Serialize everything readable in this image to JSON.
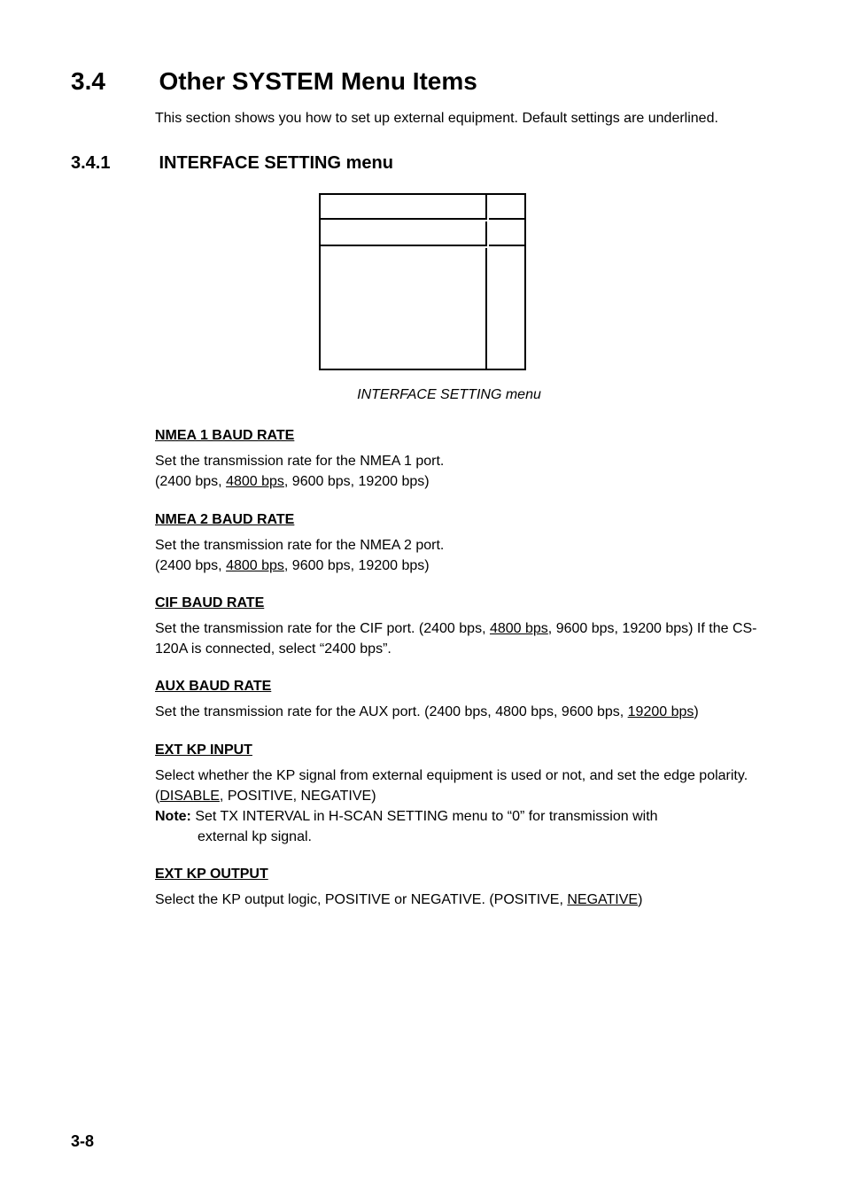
{
  "section": {
    "number": "3.4",
    "title": "Other SYSTEM Menu Items",
    "intro": "This section shows you how to set up external equipment. Default settings are underlined."
  },
  "subsection": {
    "number": "3.4.1",
    "title": "INTERFACE SETTING menu"
  },
  "figure": {
    "caption": "INTERFACE SETTING menu"
  },
  "items": {
    "nmea1": {
      "header": "NMEA 1 BAUD RATE",
      "line1": "Set the transmission rate for the NMEA 1 port.",
      "prefix": "(2400 bps, ",
      "default": "4800 bps",
      "suffix": ", 9600 bps, 19200 bps)"
    },
    "nmea2": {
      "header": "NMEA 2 BAUD RATE",
      "line1": "Set the transmission rate for the NMEA 2 port.",
      "prefix": "(2400 bps, ",
      "default": "4800 bps",
      "suffix": ", 9600 bps, 19200 bps)"
    },
    "cif": {
      "header": "CIF BAUD RATE",
      "prefix": "Set the transmission rate for the CIF port. (2400 bps, ",
      "default": "4800 bps",
      "suffix": ", 9600 bps, 19200 bps) If the CS-120A is connected, select “2400 bps”."
    },
    "aux": {
      "header": "AUX BAUD RATE",
      "prefix": "Set the transmission rate for the AUX port. (2400 bps, 4800 bps, 9600 bps, ",
      "default": "19200 bps",
      "suffix": ")"
    },
    "kpin": {
      "header": "EXT KP INPUT",
      "prefix": "Select whether the KP signal from external equipment is used or not, and set the edge polarity. (",
      "default": "DISABLE",
      "suffix": ", POSITIVE, NEGATIVE)",
      "note_label": "Note:",
      "note_text": " Set TX INTERVAL in H-SCAN SETTING menu to “0” for transmission with",
      "note_cont": "external kp signal."
    },
    "kpout": {
      "header": "EXT KP OUTPUT",
      "prefix": "Select the KP output logic, POSITIVE or NEGATIVE. (POSITIVE, ",
      "default": "NEGATIVE",
      "suffix": ")"
    }
  },
  "page_number": "3-8"
}
